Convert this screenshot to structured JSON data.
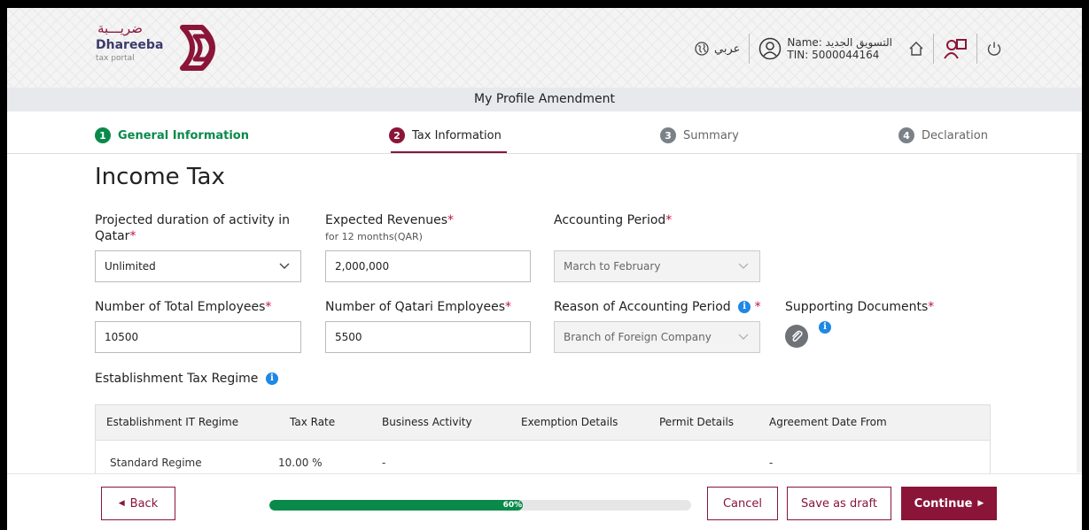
{
  "header": {
    "logo": {
      "arabic": "ضريـــبة",
      "english": "Dhareeba",
      "sub": "tax portal"
    },
    "language_label": "عربي",
    "user_name_line": "Name: التسويق الجديد",
    "user_tin_line": "TIN: 5000044164"
  },
  "page_title": "My Profile Amendment",
  "steps": [
    {
      "num": "1",
      "label": "General Information",
      "state": "completed"
    },
    {
      "num": "2",
      "label": "Tax Information",
      "state": "active"
    },
    {
      "num": "3",
      "label": "Summary",
      "state": "pending"
    },
    {
      "num": "4",
      "label": "Declaration",
      "state": "pending"
    }
  ],
  "form": {
    "section_title": "Income Tax",
    "duration": {
      "label_line1": "Projected duration of activity in",
      "label_line2": "Qatar",
      "value": "Unlimited"
    },
    "revenues": {
      "label": "Expected Revenues",
      "sublabel": "for 12 months(QAR)",
      "value": "2,000,000"
    },
    "accounting_period": {
      "label": "Accounting Period",
      "value": "March to February"
    },
    "total_employees": {
      "label": "Number of Total Employees",
      "value": "10500"
    },
    "qatari_employees": {
      "label": "Number of Qatari Employees",
      "value": "5500"
    },
    "reason_period": {
      "label": "Reason of Accounting Period",
      "value": "Branch of Foreign Company"
    },
    "supporting_docs": {
      "label": "Supporting Documents"
    },
    "required_mark": "*",
    "info_glyph": "i"
  },
  "regime": {
    "label": "Establishment Tax Regime",
    "columns": [
      "Establishment IT Regime",
      "Tax Rate",
      "Business Activity",
      "Exemption Details",
      "Permit Details",
      "Agreement Date From"
    ],
    "rows": [
      [
        "Standard Regime",
        "10.00 %",
        "-",
        "",
        "",
        "-"
      ]
    ]
  },
  "footer": {
    "back_label": "Back",
    "progress_fraction": 0.6,
    "progress_text": "60%",
    "cancel_label": "Cancel",
    "save_draft_label": "Save as draft",
    "continue_label": "Continue"
  },
  "colors": {
    "brand": "#8a1538",
    "success": "#0a8a4a",
    "info": "#1e88e5"
  },
  "icons": [
    "globe-icon",
    "user-circle-icon",
    "home-icon",
    "users-icon",
    "power-icon",
    "info-icon",
    "paperclip-icon",
    "chevron-down-icon",
    "caret-left-icon",
    "caret-right-icon"
  ]
}
